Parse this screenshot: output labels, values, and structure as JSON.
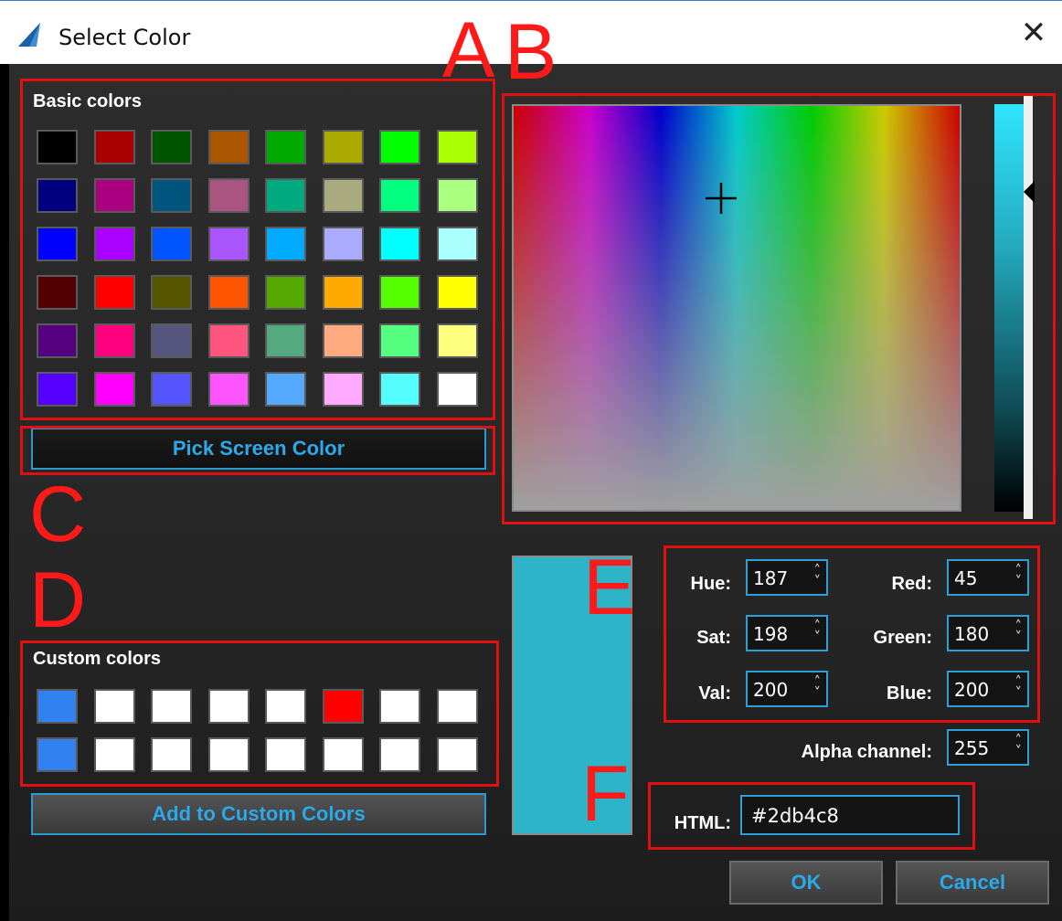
{
  "window": {
    "title": "Select Color",
    "close_glyph": "✕",
    "app_icon": "app-logo-icon"
  },
  "basic_colors": {
    "label": "Basic colors",
    "swatches": [
      "#000000",
      "#aa0000",
      "#005500",
      "#aa5500",
      "#00aa00",
      "#aaaa00",
      "#00ff00",
      "#aaff00",
      "#00007f",
      "#aa007f",
      "#00557f",
      "#aa557f",
      "#00aa7f",
      "#aaaa7f",
      "#00ff7f",
      "#aaff7f",
      "#0000ff",
      "#aa00ff",
      "#0055ff",
      "#aa55ff",
      "#00aaff",
      "#aaaaff",
      "#00ffff",
      "#aaffff",
      "#550000",
      "#ff0000",
      "#555500",
      "#ff5500",
      "#55aa00",
      "#ffaa00",
      "#55ff00",
      "#ffff00",
      "#55007f",
      "#ff007f",
      "#55557f",
      "#ff557f",
      "#55aa7f",
      "#ffaa7f",
      "#55ff7f",
      "#ffff7f",
      "#5500ff",
      "#ff00ff",
      "#5555ff",
      "#ff55ff",
      "#55aaff",
      "#ffaaff",
      "#55ffff",
      "#ffffff"
    ]
  },
  "pick_screen_button": "Pick Screen Color",
  "custom_colors": {
    "label": "Custom colors",
    "swatches": [
      "#3281f2",
      "#ffffff",
      "#ffffff",
      "#ffffff",
      "#ffffff",
      "#ff0000",
      "#ffffff",
      "#ffffff",
      "#3281f2",
      "#ffffff",
      "#ffffff",
      "#ffffff",
      "#ffffff",
      "#ffffff",
      "#ffffff",
      "#ffffff"
    ]
  },
  "add_custom_button": "Add to Custom Colors",
  "current_color": "#2db4c8",
  "fields": {
    "hue": {
      "label": "Hue:",
      "value": "187"
    },
    "sat": {
      "label": "Sat:",
      "value": "198"
    },
    "val": {
      "label": "Val:",
      "value": "200"
    },
    "red": {
      "label": "Red:",
      "value": "45"
    },
    "green": {
      "label": "Green:",
      "value": "180"
    },
    "blue": {
      "label": "Blue:",
      "value": "200"
    },
    "alpha": {
      "label": "Alpha channel:",
      "value": "255"
    },
    "html": {
      "label": "HTML:",
      "value": "#2db4c8"
    }
  },
  "spin_arrows": "⁚",
  "buttons": {
    "ok": "OK",
    "cancel": "Cancel"
  },
  "annotations": {
    "A": "A",
    "B": "B",
    "C": "C",
    "D": "D",
    "E": "E",
    "F": "F",
    "color": "#e01010"
  }
}
